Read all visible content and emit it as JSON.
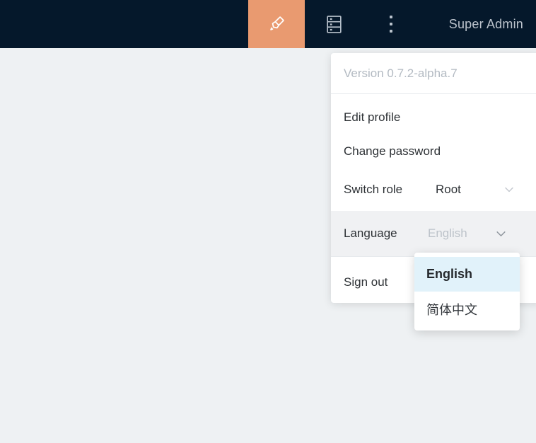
{
  "colors": {
    "header_bg": "#05182b",
    "accent": "#e99a70",
    "page_bg": "#eef1f3",
    "menu_text": "#2e3236",
    "muted_text": "#b3bac2",
    "language_row_bg": "#f0f1f3",
    "submenu_selected_bg": "#e1f2fa",
    "divider": "#e7eaed",
    "header_icon": "#b9c2cc"
  },
  "header": {
    "user_label": "Super Admin",
    "accent_icon": "mark-pen-icon",
    "logs_icon": "logs-icon",
    "more_icon": "kebab-menu-icon"
  },
  "menu": {
    "version": "Version 0.7.2-alpha.7",
    "items": [
      {
        "id": "edit-profile",
        "label": "Edit profile"
      },
      {
        "id": "change-password",
        "label": "Change password"
      },
      {
        "id": "switch-role",
        "label": "Switch role",
        "value": "Root"
      },
      {
        "id": "language",
        "label": "Language",
        "value": "English"
      },
      {
        "id": "sign-out",
        "label": "Sign out"
      }
    ]
  },
  "submenu": {
    "options": [
      {
        "label": "English",
        "selected": true
      },
      {
        "label": "简体中文",
        "selected": false
      }
    ]
  }
}
